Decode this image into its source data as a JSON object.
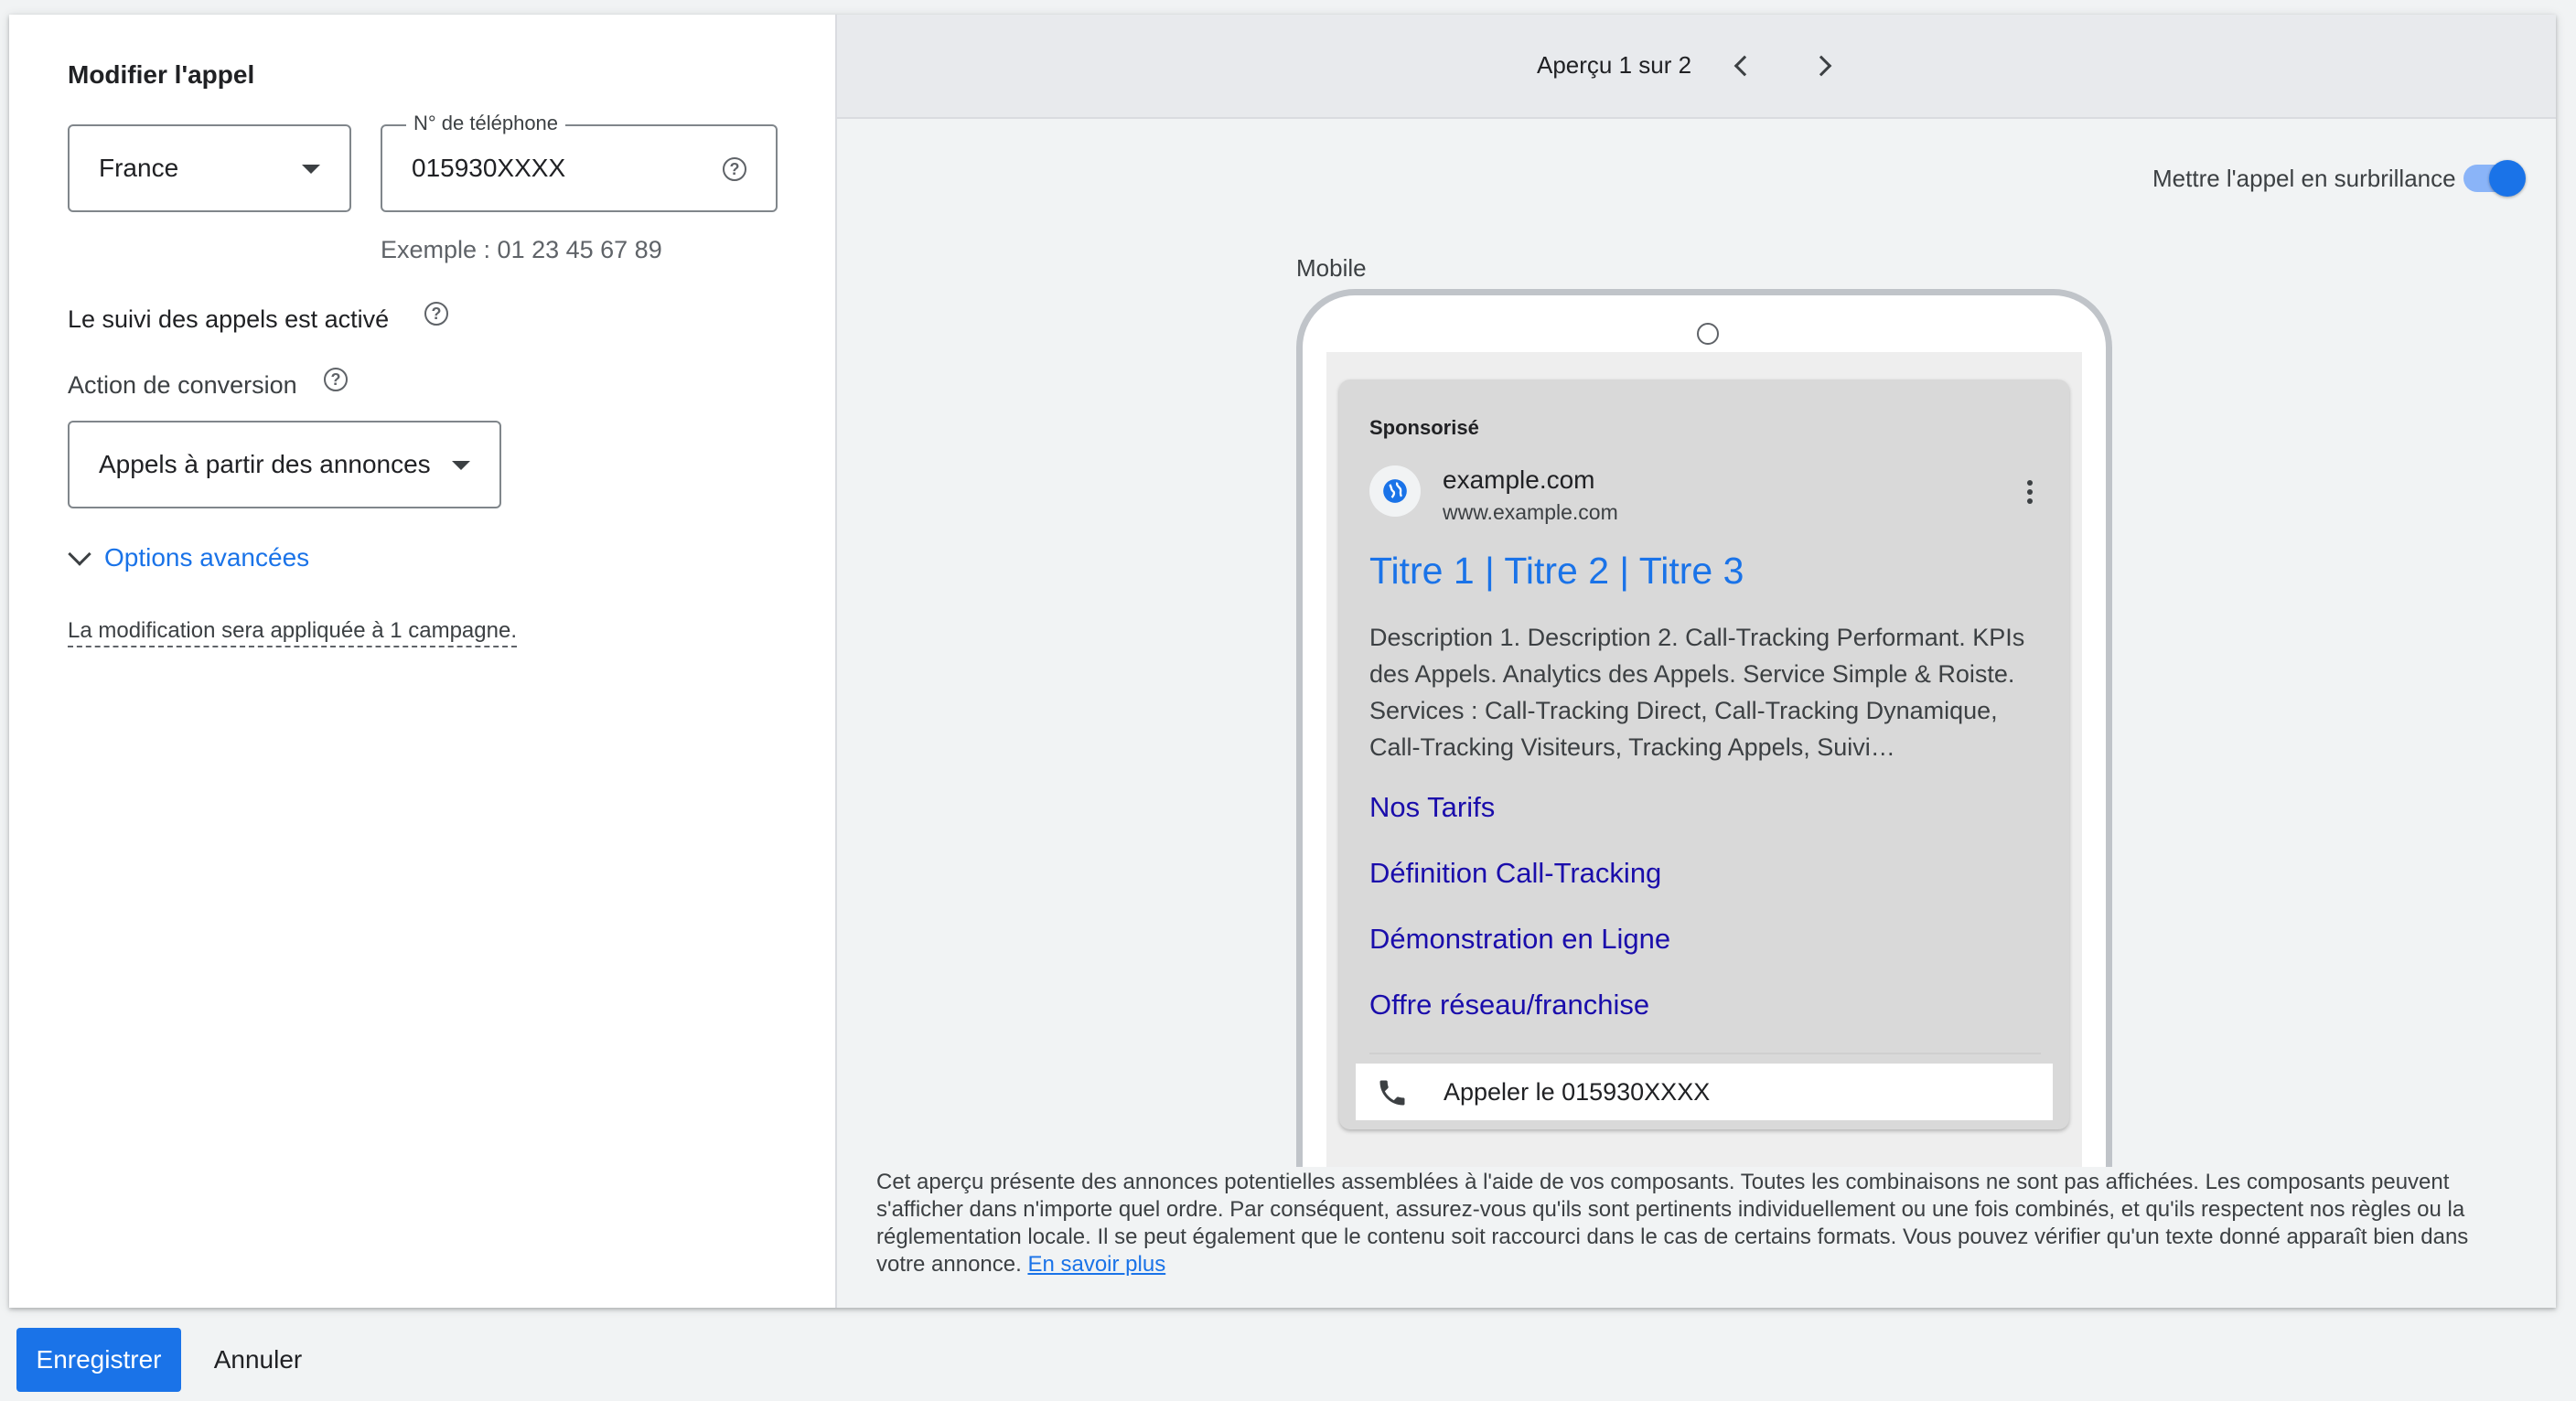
{
  "panel": {
    "title": "Modifier l'appel",
    "country": "France",
    "phone_label": "N° de téléphone",
    "phone_value": "015930XXXX",
    "example": "Exemple : 01 23 45 67 89",
    "tracking_text": "Le suivi des appels est activé",
    "conversion_label": "Action de conversion",
    "conversion_value": "Appels à partir des annonces",
    "advanced_options": "Options avancées",
    "campaign_note": "La modification sera appliquée à 1 campagne."
  },
  "preview": {
    "nav_text": "Aperçu 1 sur 2",
    "highlight_label": "Mettre l'appel en surbrillance",
    "highlight_enabled": true,
    "device_label": "Mobile",
    "ad": {
      "sponsored": "Sponsorisé",
      "site_name": "example.com",
      "site_url": "www.example.com",
      "title": "Titre 1 | Titre 2 | Titre 3",
      "description": "Description 1. Description 2. Call-Tracking Performant. KPIs des Appels. Analytics des Appels. Service Simple & Roiste. Services : Call-Tracking Direct, Call-Tracking Dynamique, Call-Tracking Visiteurs, Tracking Appels, Suivi…",
      "sitelinks": [
        "Nos Tarifs",
        "Définition Call-Tracking",
        "Démonstration en Ligne",
        "Offre réseau/franchise"
      ],
      "call_text": "Appeler le 015930XXXX"
    },
    "disclaimer": "Cet aperçu présente des annonces potentielles assemblées à l'aide de vos composants. Toutes les combinaisons ne sont pas affichées. Les composants peuvent s'afficher dans n'importe quel ordre. Par conséquent, assurez-vous qu'ils sont pertinents individuellement ou une fois combinés, et qu'ils respectent nos règles ou la réglementation locale. Il se peut également que le contenu soit raccourci dans le cas de certains formats. Vous pouvez vérifier qu'un texte donné apparaît bien dans votre annonce.",
    "learn_more": "En savoir plus"
  },
  "footer": {
    "save": "Enregistrer",
    "cancel": "Annuler"
  },
  "colors": {
    "accent": "#1a73e8",
    "link": "#1a0dab"
  }
}
